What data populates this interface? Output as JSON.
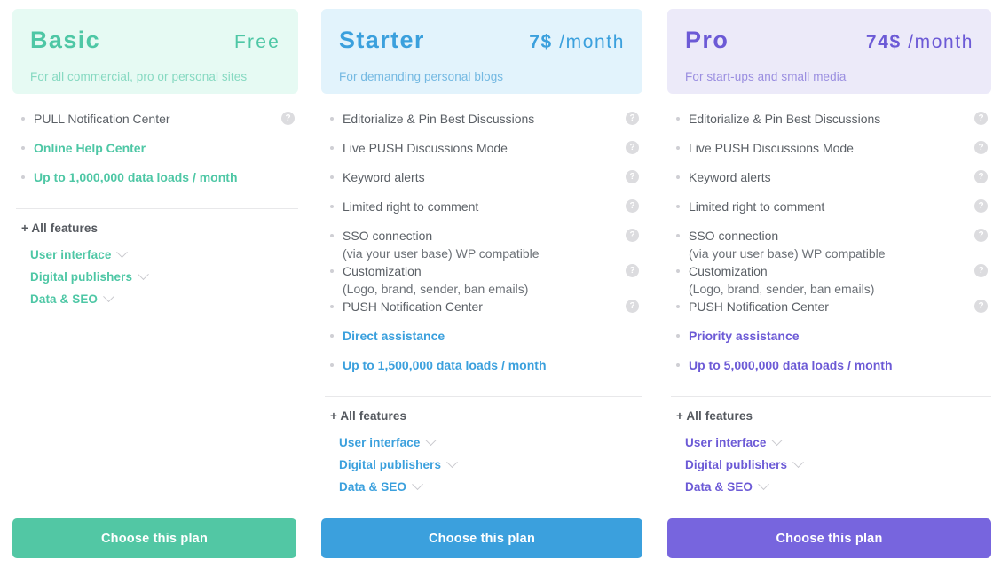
{
  "plans": [
    {
      "id": "basic",
      "name": "Basic",
      "price_amount": "",
      "price_unit": "Free",
      "price_is_free": true,
      "tagline": "For all commercial, pro or personal sites",
      "accent_color": "#4ec7a5",
      "header_bg": "#e6faf3",
      "button_color": "#52c7a4",
      "cta_label": "Choose this plan",
      "all_features_label": "+ All features",
      "features": [
        {
          "text": "PULL Notification Center",
          "sub": "",
          "highlight": false,
          "help": true
        },
        {
          "text": "Online Help Center",
          "sub": "",
          "highlight": true,
          "help": false
        },
        {
          "text": "Up to 1,000,000 data loads / month",
          "sub": "",
          "highlight": true,
          "help": false
        }
      ],
      "categories": [
        {
          "label": "User interface"
        },
        {
          "label": "Digital publishers"
        },
        {
          "label": "Data & SEO"
        }
      ]
    },
    {
      "id": "starter",
      "name": "Starter",
      "price_amount": "7$",
      "price_unit": "/month",
      "price_is_free": false,
      "tagline": "For demanding personal blogs",
      "accent_color": "#3ba0dd",
      "header_bg": "#e2f3fc",
      "button_color": "#3ba0dd",
      "cta_label": "Choose this plan",
      "all_features_label": "+ All features",
      "features": [
        {
          "text": "Editorialize & Pin Best Discussions",
          "sub": "",
          "highlight": false,
          "help": true
        },
        {
          "text": "Live PUSH Discussions Mode",
          "sub": "",
          "highlight": false,
          "help": true
        },
        {
          "text": "Keyword alerts",
          "sub": "",
          "highlight": false,
          "help": true
        },
        {
          "text": "Limited right to comment",
          "sub": "",
          "highlight": false,
          "help": true
        },
        {
          "text": "SSO connection",
          "sub": "(via your user base) WP compatible",
          "highlight": false,
          "help": true
        },
        {
          "text": "Customization",
          "sub": "(Logo, brand, sender, ban emails)",
          "highlight": false,
          "help": true
        },
        {
          "text": "PUSH Notification Center",
          "sub": "",
          "highlight": false,
          "help": true
        },
        {
          "text": "Direct assistance",
          "sub": "",
          "highlight": true,
          "help": false
        },
        {
          "text": "Up to 1,500,000 data loads / month",
          "sub": "",
          "highlight": true,
          "help": false
        }
      ],
      "categories": [
        {
          "label": "User interface"
        },
        {
          "label": "Digital publishers"
        },
        {
          "label": "Data & SEO"
        }
      ]
    },
    {
      "id": "pro",
      "name": "Pro",
      "price_amount": "74$",
      "price_unit": "/month",
      "price_is_free": false,
      "tagline": "For start-ups and small media",
      "accent_color": "#6c5ad6",
      "header_bg": "#eceaf9",
      "button_color": "#7765de",
      "cta_label": "Choose this plan",
      "all_features_label": "+ All features",
      "features": [
        {
          "text": "Editorialize & Pin Best Discussions",
          "sub": "",
          "highlight": false,
          "help": true
        },
        {
          "text": "Live PUSH Discussions Mode",
          "sub": "",
          "highlight": false,
          "help": true
        },
        {
          "text": "Keyword alerts",
          "sub": "",
          "highlight": false,
          "help": true
        },
        {
          "text": "Limited right to comment",
          "sub": "",
          "highlight": false,
          "help": true
        },
        {
          "text": "SSO connection",
          "sub": "(via your user base) WP compatible",
          "highlight": false,
          "help": true
        },
        {
          "text": "Customization",
          "sub": "(Logo, brand, sender, ban emails)",
          "highlight": false,
          "help": true
        },
        {
          "text": "PUSH Notification Center",
          "sub": "",
          "highlight": false,
          "help": true
        },
        {
          "text": "Priority assistance",
          "sub": "",
          "highlight": true,
          "help": false
        },
        {
          "text": "Up to 5,000,000 data loads / month",
          "sub": "",
          "highlight": true,
          "help": false
        }
      ],
      "categories": [
        {
          "label": "User interface"
        },
        {
          "label": "Digital publishers"
        },
        {
          "label": "Data & SEO"
        }
      ]
    }
  ],
  "icons": {
    "help": "?",
    "chevron_down": "chevron-down-icon"
  }
}
